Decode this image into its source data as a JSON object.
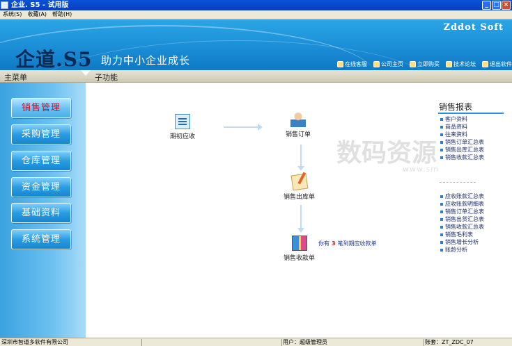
{
  "window": {
    "title": "企业. S5 - 试用版",
    "controls": {
      "minimize": "_",
      "maximize": "□",
      "close": "×"
    }
  },
  "menubar": {
    "items": [
      "系统(S)",
      "收藏(A)",
      "帮助(H)"
    ]
  },
  "banner": {
    "logo_text": "企道.S5",
    "slogan": "助力中小企业成长",
    "company": "Zddot Soft",
    "links": [
      {
        "label": "在线客服",
        "icon": "headset-icon"
      },
      {
        "label": "公司主页",
        "icon": "home-icon"
      },
      {
        "label": "立即购买",
        "icon": "cart-icon"
      },
      {
        "label": "技术论坛",
        "icon": "forum-icon"
      },
      {
        "label": "退出软件",
        "icon": "exit-icon"
      }
    ]
  },
  "section": {
    "main_menu": "主菜单",
    "sub_function": "子功能"
  },
  "sidebar": {
    "items": [
      {
        "label": "销售管理",
        "active": true
      },
      {
        "label": "采购管理",
        "active": false
      },
      {
        "label": "仓库管理",
        "active": false
      },
      {
        "label": "资金管理",
        "active": false
      },
      {
        "label": "基础资料",
        "active": false
      },
      {
        "label": "系统管理",
        "active": false
      }
    ]
  },
  "flow": {
    "nodes": [
      {
        "label": "期初应收",
        "icon": "ledger-icon"
      },
      {
        "label": "销售订单",
        "icon": "salesperson-icon"
      },
      {
        "label": "销售出库单",
        "icon": "delivery-note-icon"
      },
      {
        "label": "销售收款单",
        "icon": "payment-gift-icon"
      }
    ],
    "notice": {
      "prefix": "你有",
      "count": "3",
      "suffix": "笔到期应收款单"
    }
  },
  "reports": {
    "title": "销售报表",
    "group1": [
      "客户资料",
      "商品资料",
      "往来资料",
      "销售订单汇总表",
      "销售出库汇总表",
      "销售收款汇总表"
    ],
    "group2": [
      "应收账款汇总表",
      "应收账款明细表",
      "销售订单汇总表",
      "销售出货汇总表",
      "销售收款汇总表",
      "销售毛利表",
      "销售增长分析",
      "账龄分析"
    ]
  },
  "watermark": {
    "text": "数码资源网",
    "sub": "www.smzy.com"
  },
  "statusbar": {
    "company": "深圳市智道多软件有限公司",
    "user": "用户：超级管理员",
    "account": "账套：ZT_ZDC_07"
  }
}
